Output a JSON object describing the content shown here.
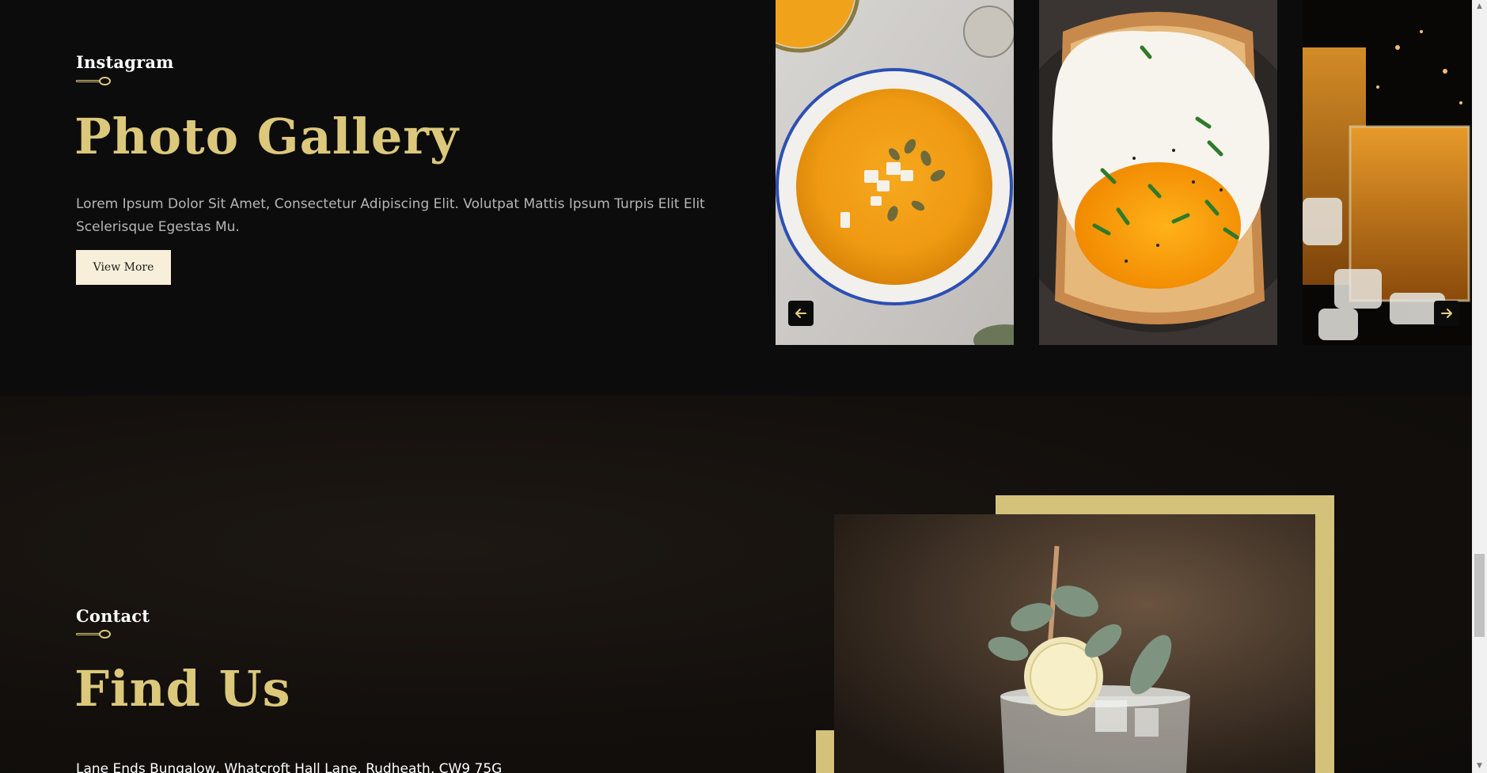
{
  "gallery": {
    "eyebrow": "Instagram",
    "title": "Photo Gallery",
    "description": "Lorem Ipsum Dolor Sit Amet, Consectetur Adipiscing Elit. Volutpat Mattis Ipsum Turpis Elit Elit Scelerisque Egestas Mu.",
    "button_label": "View More",
    "prev_icon": "arrow-left-icon",
    "next_icon": "arrow-right-icon"
  },
  "contact": {
    "eyebrow": "Contact",
    "title": "Find Us",
    "address": "Lane Ends Bungalow, Whatcroft Hall Lane, Rudheath, CW9 75G"
  },
  "colors": {
    "accent_gold": "#dcc87a",
    "frame_gold": "#d4c27a",
    "button_bg": "#f7efd9",
    "page_bg": "#0c0c0c"
  }
}
